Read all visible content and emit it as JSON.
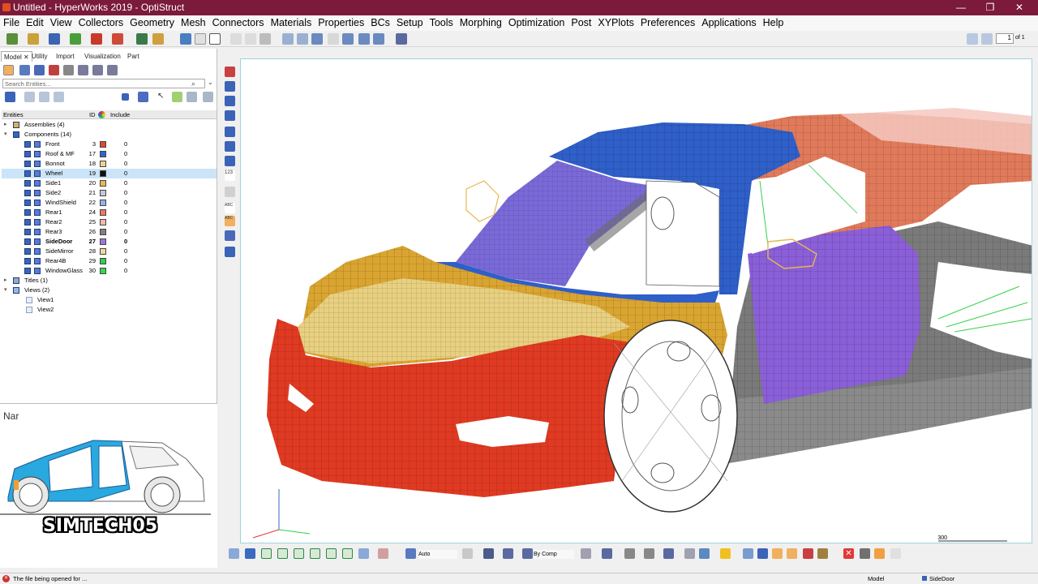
{
  "window": {
    "title": "Untitled - HyperWorks 2019 - OptiStruct",
    "minimize": "—",
    "maximize": "❐",
    "close": "✕"
  },
  "menu": [
    "File",
    "Edit",
    "View",
    "Collectors",
    "Geometry",
    "Mesh",
    "Connectors",
    "Materials",
    "Properties",
    "BCs",
    "Setup",
    "Tools",
    "Morphing",
    "Optimization",
    "Post",
    "XYPlots",
    "Preferences",
    "Applications",
    "Help"
  ],
  "pager": {
    "value": "1",
    "of": "of 1"
  },
  "panel_tabs": [
    "Model",
    "Utility",
    "Import",
    "Visualization",
    "Part"
  ],
  "panel_tab_close": "✕",
  "search": {
    "placeholder": "Search Entities..."
  },
  "entity_header": {
    "entities": "Entities",
    "id": "ID",
    "include": "Include"
  },
  "tree": {
    "assemblies": "Assemblies (4)",
    "components": "Components (14)",
    "titles": "Titles (1)",
    "views": "Views (2)",
    "view_items": [
      "View1",
      "View2"
    ],
    "component_rows": [
      {
        "name": "Front",
        "id": "3",
        "color": "#e04a2a",
        "include": "0"
      },
      {
        "name": "Roof & MF",
        "id": "17",
        "color": "#2f66d2",
        "include": "0"
      },
      {
        "name": "Bonnot",
        "id": "18",
        "color": "#f2d28a",
        "include": "0"
      },
      {
        "name": "Wheel",
        "id": "19",
        "color": "#111111",
        "include": "0"
      },
      {
        "name": "Side1",
        "id": "20",
        "color": "#e8b850",
        "include": "0"
      },
      {
        "name": "Side2",
        "id": "21",
        "color": "#c7c7d6",
        "include": "0"
      },
      {
        "name": "WindShield",
        "id": "22",
        "color": "#8fb4e8",
        "include": "0"
      },
      {
        "name": "Rear1",
        "id": "24",
        "color": "#f07560",
        "include": "0"
      },
      {
        "name": "Rear2",
        "id": "25",
        "color": "#f4b8a8",
        "include": "0"
      },
      {
        "name": "Rear3",
        "id": "26",
        "color": "#808080",
        "include": "0"
      },
      {
        "name": "SideDoor",
        "id": "27",
        "color": "#9b78e0",
        "include": "0"
      },
      {
        "name": "SideMirror",
        "id": "28",
        "color": "#f2d89a",
        "include": "0"
      },
      {
        "name": "Rear4B",
        "id": "29",
        "color": "#2fcf4a",
        "include": "0"
      },
      {
        "name": "WindowGlass",
        "id": "30",
        "color": "#34d94c",
        "include": "0"
      }
    ]
  },
  "lower_panel": {
    "label": "Nar",
    "logo": "SIMTECH05"
  },
  "viewport": {
    "scale": "300"
  },
  "bottom_toolbar": {
    "auto": "Auto",
    "by_comp": "By Comp"
  },
  "status": {
    "message": "The file being opened for ...",
    "model": "Model",
    "component": "SideDoor"
  },
  "colors": {
    "titlebar": "#7b1a3a",
    "selection": "#cce4f7"
  }
}
